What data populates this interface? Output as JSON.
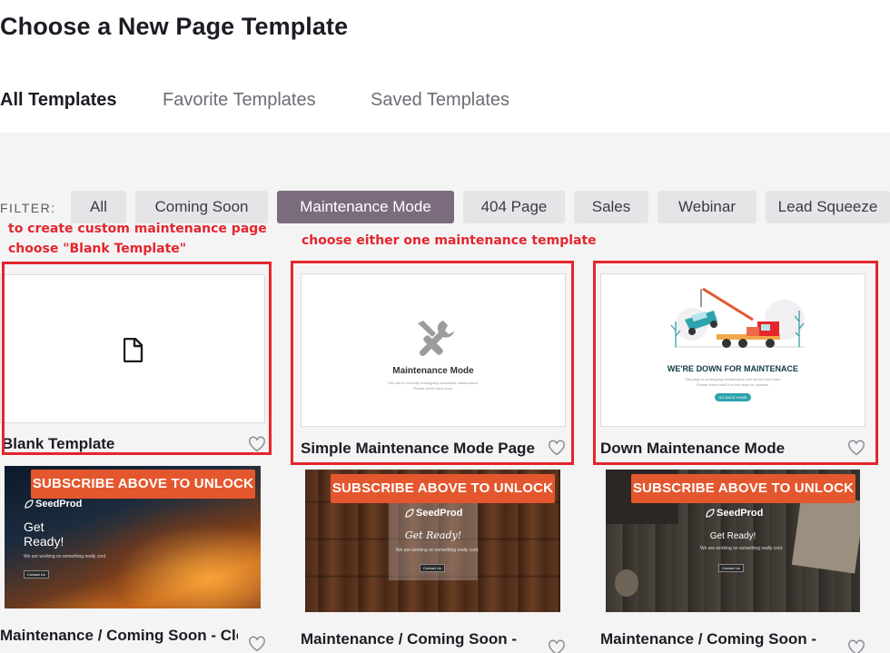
{
  "page_title": "Choose a New Page Template",
  "tabs": [
    {
      "label": "All Templates"
    },
    {
      "label": "Favorite Templates"
    },
    {
      "label": "Saved Templates"
    }
  ],
  "filter": {
    "label": "FILTER:",
    "chips": [
      {
        "label": "All"
      },
      {
        "label": "Coming Soon"
      },
      {
        "label": "Maintenance Mode"
      },
      {
        "label": "404 Page"
      },
      {
        "label": "Sales"
      },
      {
        "label": "Webinar"
      },
      {
        "label": "Lead Squeeze"
      }
    ]
  },
  "annotations": {
    "blank_line1": "to create custom maintenance page",
    "blank_line2": "choose \"Blank Template\"",
    "maint": "choose either one maintenance template"
  },
  "templates": [
    {
      "title": "Blank Template"
    },
    {
      "title": "Simple Maintenance Mode Page",
      "thumb_heading": "Maintenance Mode",
      "thumb_sub1": "This site is currently undergoing scheduled maintenance.",
      "thumb_sub2": "Please check back soon."
    },
    {
      "title": "Down Maintenance Mode",
      "thumb_heading": "WE'RE DOWN FOR MAINTENACE",
      "thumb_sub1": "This page is undergoing maintenance and will be back soon.",
      "thumb_sub2": "Please check back in a few days for updates.",
      "thumb_btn": "GO BACK HOME"
    },
    {
      "title": "Maintenance / Coming Soon - Clouds",
      "unlock": "SUBSCRIBE ABOVE TO UNLOCK",
      "brand": "SeedProd",
      "headline1": "Get",
      "headline2": "Ready!",
      "sub": "We are working on something really cool.",
      "btn": "Contact Us"
    },
    {
      "title": "Maintenance / Coming Soon -",
      "unlock": "SUBSCRIBE ABOVE TO UNLOCK",
      "brand": "SeedProd",
      "headline": "Get Ready!",
      "sub": "We are working on something really cool.",
      "btn": "Contact Us"
    },
    {
      "title": "Maintenance / Coming Soon -",
      "unlock": "SUBSCRIBE ABOVE TO UNLOCK",
      "brand": "SeedProd",
      "headline": "Get Ready!",
      "sub": "We are working on something really cool.",
      "btn": "Contact Us"
    }
  ],
  "colors": {
    "accent": "#e4572e",
    "annotation_red": "#e4262d",
    "active_chip": "#7b6c7d"
  },
  "icons": [
    "file-icon",
    "tools-icon",
    "heart-icon",
    "leaf-logo-icon"
  ]
}
